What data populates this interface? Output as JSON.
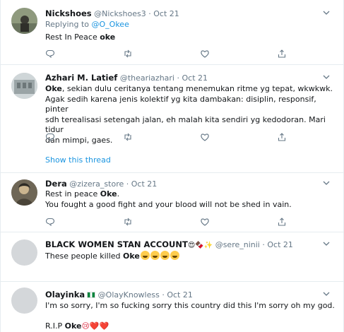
{
  "tweets": [
    {
      "name": "Nickshoes",
      "handle": "@Nickshoes3",
      "sep": "·",
      "date": "Oct 21",
      "replying_prefix": "Replying to",
      "replying_handle": "@O_Okee",
      "text_before": "Rest In Peace ",
      "text_bold": "oke"
    },
    {
      "name": "Azhari M. Latief",
      "handle": "@theariazhari",
      "sep": "·",
      "date": "Oct 21",
      "text_bold": "Oke",
      "text_after": ", sekian dulu ceritanya tentang menemukan ritme yg tepat, wkwkwk.",
      "line2": "Agak sedih karena jenis kolektif yg kita dambakan: disiplin, responsif, pinter",
      "line3": "sdh terealisasi setengah jalan, eh malah kita sendiri yg kedodoran. Mari tidur",
      "line4": "dan mimpi, gaes.",
      "show_thread": "Show this thread"
    },
    {
      "name": "Dera",
      "handle": "@zizera_store",
      "sep": "·",
      "date": "Oct 21",
      "text_before": "Rest in peace ",
      "text_bold": "Oke",
      "text_after": ".",
      "line2": "You fought a good fight and your blood will not be shed in vain."
    },
    {
      "name": "BLACK WOMEN STAN ACCOUNT",
      "name_emoji": "😍🍫✨",
      "handle": "@sere_ninii",
      "sep": "·",
      "date": "Oct 21",
      "text_before": "These people killed ",
      "text_bold": "Oke"
    },
    {
      "name": "Olayinka",
      "handle": "@OlayKnowless",
      "sep": "·",
      "date": "Oct 21",
      "text": "I'm so sorry, I'm so fucking sorry this country did this I'm sorry oh my god.",
      "line2_before": "R.I.P ",
      "line2_bold": "Oke",
      "line2_emoji": "😢❤️❤️"
    }
  ],
  "icons": {
    "reply": "reply-icon",
    "retweet": "retweet-icon",
    "like": "heart-icon",
    "share": "share-icon",
    "caret": "chevron-down-icon"
  },
  "colors": {
    "link": "#1b95e0",
    "muted": "#657786",
    "text": "#14171a",
    "border": "#e6ecf0"
  }
}
